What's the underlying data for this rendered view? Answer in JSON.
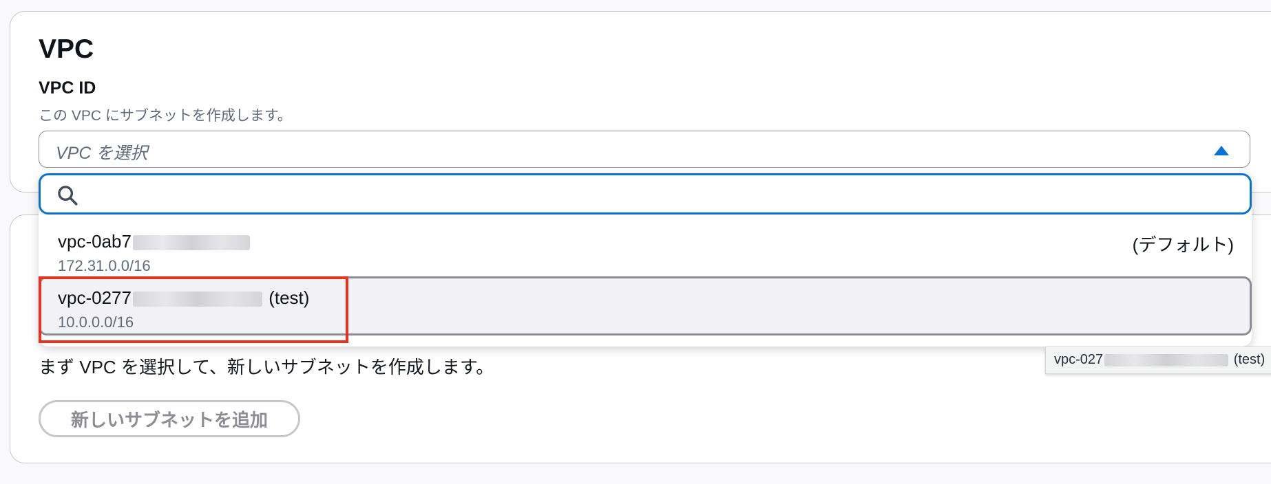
{
  "vpc_section": {
    "title": "VPC",
    "field_label": "VPC ID",
    "field_description": "この VPC にサブネットを作成します。",
    "select_placeholder": "VPC を選択",
    "search_placeholder": "",
    "search_value": "",
    "options": [
      {
        "id_prefix": "vpc-0ab7",
        "tag": "(デフォルト)",
        "cidr": "172.31.0.0/16",
        "state": "normal"
      },
      {
        "id_prefix": "vpc-0277",
        "tag": "(test)",
        "cidr": "10.0.0.0/16",
        "state": "hovered"
      }
    ]
  },
  "subnet_section": {
    "info_text": "まず VPC を選択して、新しいサブネットを作成します。",
    "add_button_label": "新しいサブネットを追加",
    "add_button_state": "disabled"
  },
  "tooltip": {
    "id_prefix": "vpc-027",
    "tag": "(test)"
  },
  "colors": {
    "accent": "#0972d3",
    "highlight": "#e8321f",
    "hover_bg": "#f1f1f6",
    "border": "#c6c6cd"
  }
}
